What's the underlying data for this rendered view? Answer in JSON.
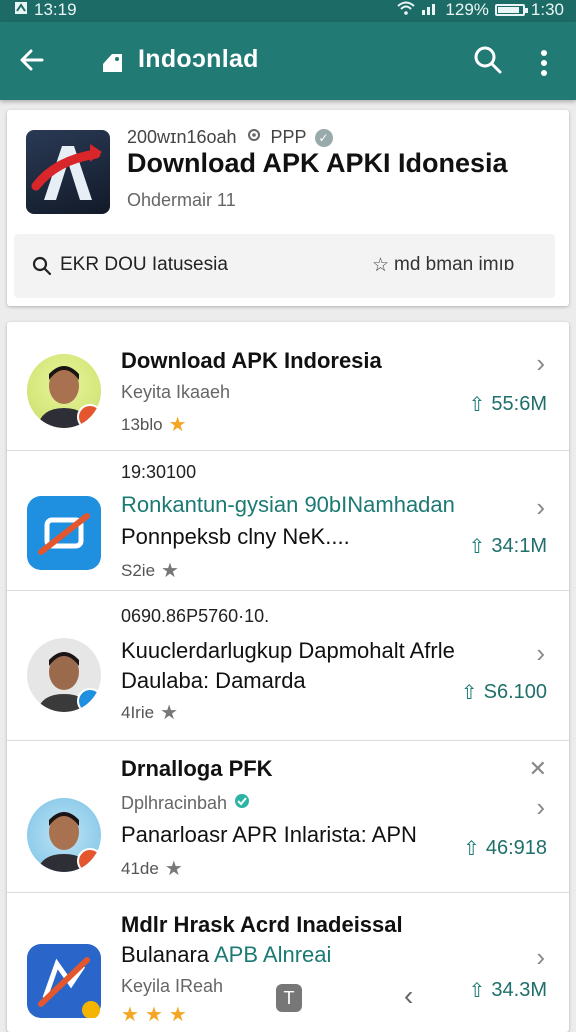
{
  "status": {
    "time": "13:19",
    "battery": "129%",
    "clock_right": "1:30",
    "battery_level": 0.8
  },
  "appbar": {
    "title": "Indoɔnlad"
  },
  "header": {
    "meta": "200wɪn16oah",
    "meta_tag": "PPP",
    "title": "Download APK APKI Idonesia",
    "subtitle": "Ohdermair 11",
    "search_text": "EKR DOU Iatusesia",
    "right_text": "md bman imıɒ"
  },
  "items": [
    {
      "title": "Download APK Indoresia",
      "sub": "Keyita Ikaaeh",
      "rating_text": "13blo",
      "stars": 1,
      "size": "55:6M"
    },
    {
      "top": "19:30100",
      "line1": "Ronkantun-gysian 90bINamhadan",
      "line2": "Ponnpeksb clny NeK....",
      "rating_text": "S2ie",
      "stars": 1,
      "size": "34:1M"
    },
    {
      "top": "0690.86P5760·10.",
      "line1": "Kuuclerdarlugkup Dapmohalt Afrle",
      "line2": "Daulaba: Damarda",
      "rating_text": "4Irie",
      "stars": 1,
      "size": "S6.100"
    },
    {
      "top": "Drnalloga PFK",
      "line1": "Dplhracinbah",
      "line2": "Panarloasr APR Inlarista: APN",
      "rating_text": "41de",
      "stars": 1,
      "size": "46:918"
    },
    {
      "top": "Mdlr Hrask Acrd Inadeissal",
      "line1": "Bulanara",
      "line1b": "APB Alnreai",
      "line2": "Keyila IReah",
      "stars": 3,
      "size": "34.3M"
    }
  ],
  "colors": {
    "accent": "#217a74",
    "star": "#f4a623"
  },
  "nav": {
    "home_label": "T"
  }
}
